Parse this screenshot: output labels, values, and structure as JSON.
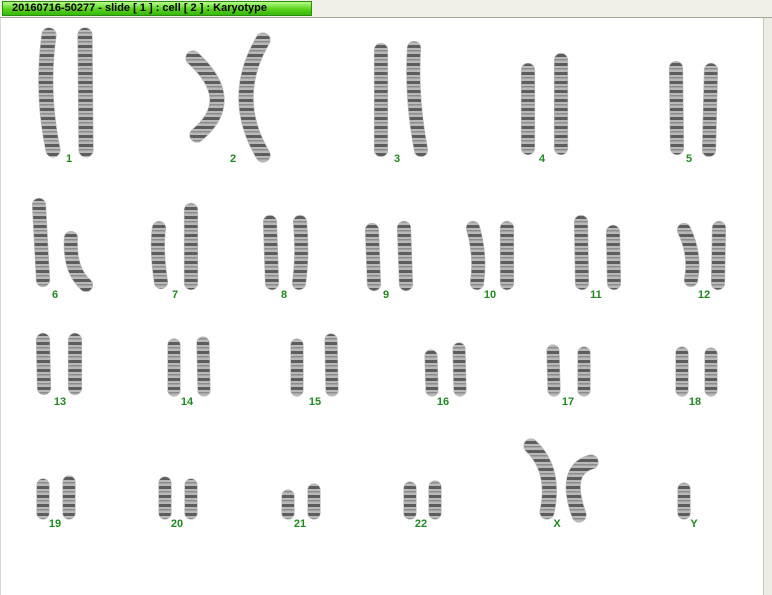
{
  "window": {
    "title": "20160716-50277 - slide [ 1 ] : cell [ 2 ] : Karyotype"
  },
  "colors": {
    "title_bar": "#58d21a",
    "label_text": "#1f8a1f",
    "chromosome": "#3c3c3c"
  },
  "karyotype": {
    "chromosomes": [
      {
        "id": "chr-1",
        "label": "1"
      },
      {
        "id": "chr-2",
        "label": "2"
      },
      {
        "id": "chr-3",
        "label": "3"
      },
      {
        "id": "chr-4",
        "label": "4"
      },
      {
        "id": "chr-5",
        "label": "5"
      },
      {
        "id": "chr-6",
        "label": "6"
      },
      {
        "id": "chr-7",
        "label": "7"
      },
      {
        "id": "chr-8",
        "label": "8"
      },
      {
        "id": "chr-9",
        "label": "9"
      },
      {
        "id": "chr-10",
        "label": "10"
      },
      {
        "id": "chr-11",
        "label": "11"
      },
      {
        "id": "chr-12",
        "label": "12"
      },
      {
        "id": "chr-13",
        "label": "13"
      },
      {
        "id": "chr-14",
        "label": "14"
      },
      {
        "id": "chr-15",
        "label": "15"
      },
      {
        "id": "chr-16",
        "label": "16"
      },
      {
        "id": "chr-17",
        "label": "17"
      },
      {
        "id": "chr-18",
        "label": "18"
      },
      {
        "id": "chr-19",
        "label": "19"
      },
      {
        "id": "chr-20",
        "label": "20"
      },
      {
        "id": "chr-21",
        "label": "21"
      },
      {
        "id": "chr-22",
        "label": "22"
      },
      {
        "id": "chr-x",
        "label": "X"
      },
      {
        "id": "chr-y",
        "label": "Y"
      }
    ]
  }
}
